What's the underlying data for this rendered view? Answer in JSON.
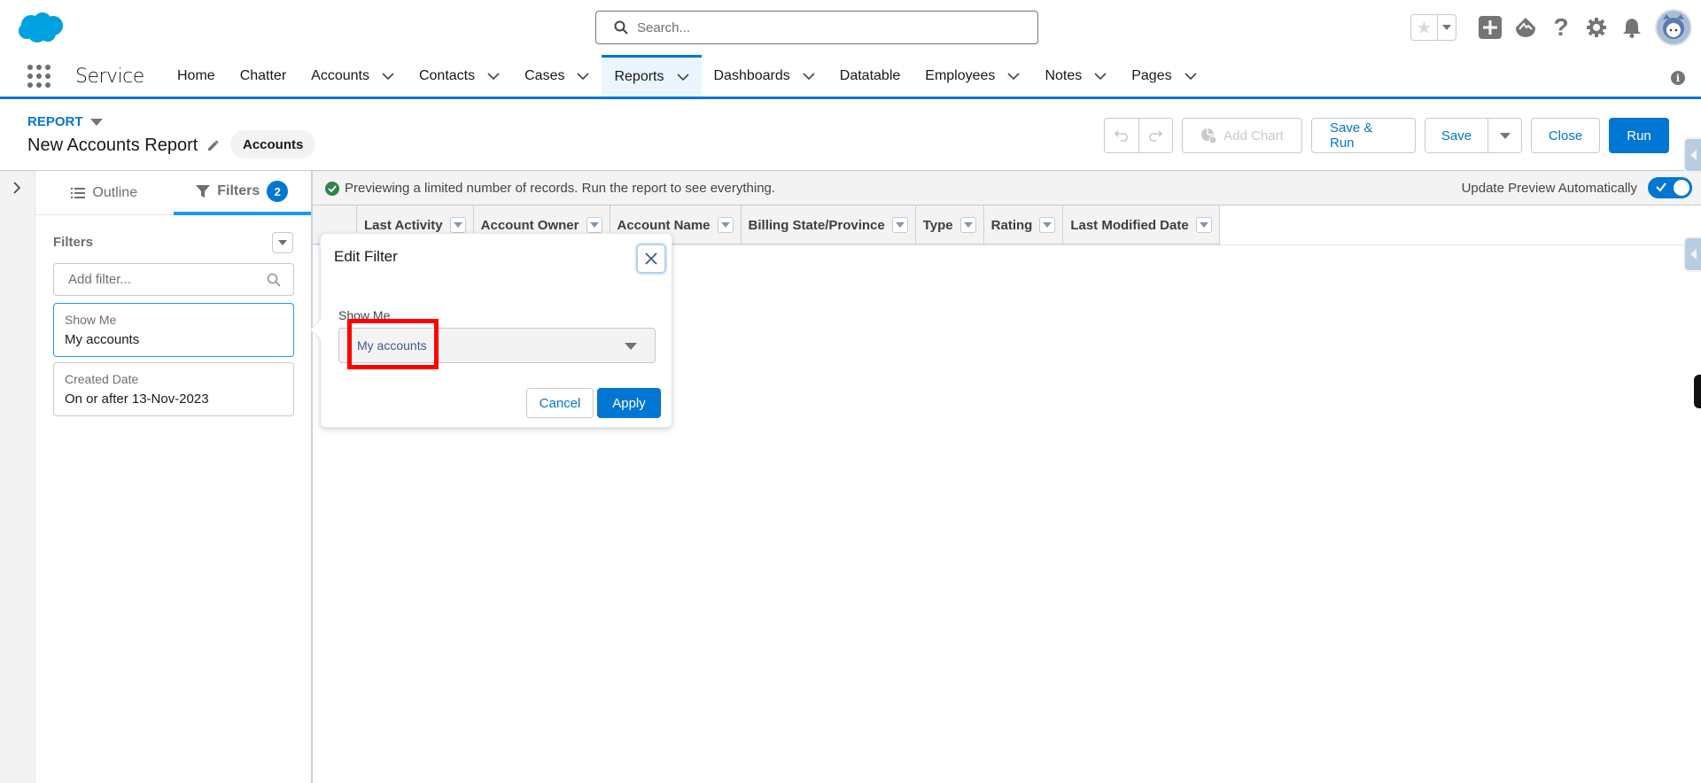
{
  "header": {
    "search_placeholder": "Search...",
    "icons": [
      "favorites-star-icon",
      "favorites-dropdown-icon",
      "global-actions-plus-icon",
      "trailhead-guidance-icon",
      "help-icon",
      "setup-gear-icon",
      "notifications-bell-icon",
      "user-avatar"
    ]
  },
  "nav": {
    "app_name": "Service",
    "items": [
      {
        "label": "Home",
        "has_menu": false
      },
      {
        "label": "Chatter",
        "has_menu": false
      },
      {
        "label": "Accounts",
        "has_menu": true
      },
      {
        "label": "Contacts",
        "has_menu": true
      },
      {
        "label": "Cases",
        "has_menu": true
      },
      {
        "label": "Reports",
        "has_menu": true,
        "active": true
      },
      {
        "label": "Dashboards",
        "has_menu": true
      },
      {
        "label": "Datatable",
        "has_menu": false
      },
      {
        "label": "Employees",
        "has_menu": true
      },
      {
        "label": "Notes",
        "has_menu": true
      },
      {
        "label": "Pages",
        "has_menu": true
      }
    ],
    "info_icon": "i"
  },
  "page_header": {
    "object_label": "REPORT",
    "title": "New Accounts Report",
    "report_type": "Accounts"
  },
  "toolbar": {
    "undo": "undo",
    "redo": "redo",
    "add_chart": "Add Chart",
    "save_and_run": "Save & Run",
    "save": "Save",
    "close": "Close",
    "run": "Run"
  },
  "panel": {
    "tabs": [
      {
        "label": "Outline"
      },
      {
        "label": "Filters",
        "count": "2",
        "active": true
      }
    ],
    "filters_heading": "Filters",
    "add_filter_placeholder": "Add filter...",
    "filters": [
      {
        "label": "Show Me",
        "value": "My accounts",
        "selected": true
      },
      {
        "label": "Created Date",
        "value": "On or after 13-Nov-2023"
      }
    ]
  },
  "preview": {
    "message": "Previewing a limited number of records. Run the report to see everything.",
    "auto_update_label": "Update Preview Automatically",
    "auto_update_on": true
  },
  "table": {
    "columns": [
      "Last Activity",
      "Account Owner",
      "Account Name",
      "Billing State/Province",
      "Type",
      "Rating",
      "Last Modified Date"
    ]
  },
  "popover": {
    "title": "Edit Filter",
    "field_label": "Show Me",
    "selected_value": "My accounts",
    "cancel": "Cancel",
    "apply": "Apply"
  },
  "colors": {
    "brand": "#0176d3",
    "highlight": "#ff0000",
    "success": "#2e844a"
  }
}
